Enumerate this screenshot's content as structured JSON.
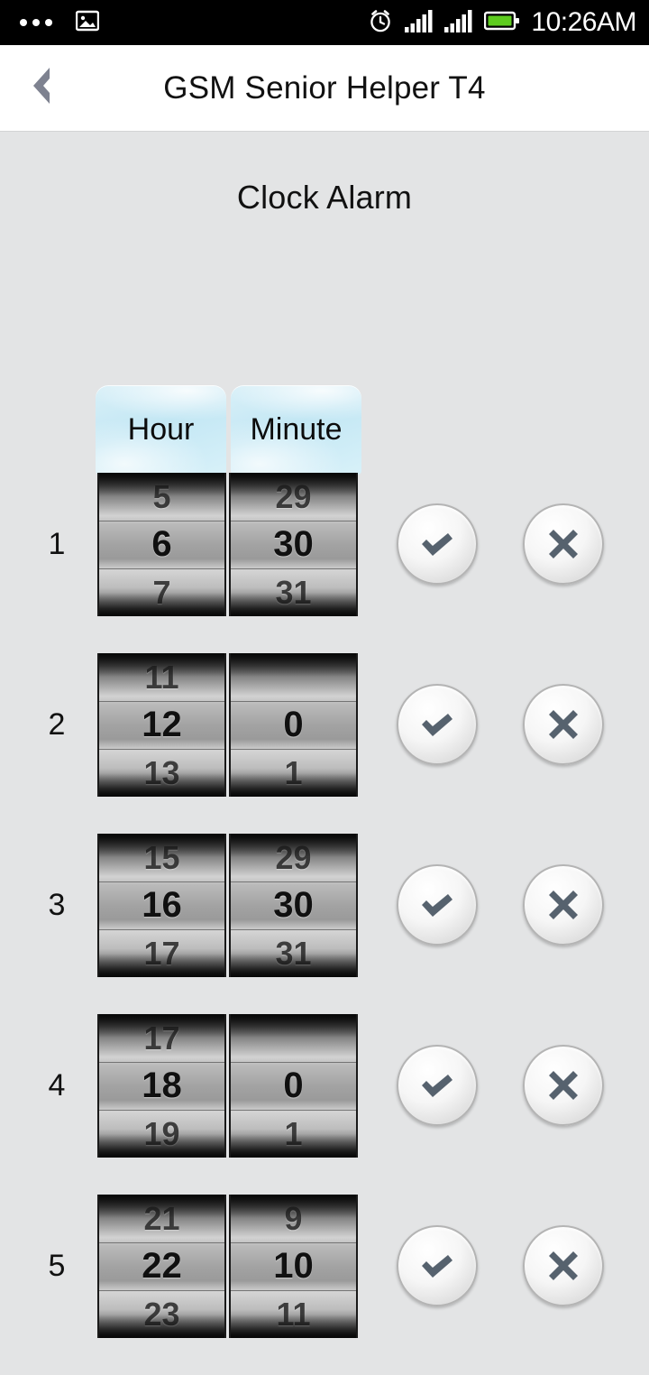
{
  "statusbar": {
    "time": "10:26AM",
    "icons": [
      "overflow-dots-icon",
      "image-icon",
      "alarm-clock-icon",
      "signal-bars-sim1-icon",
      "signal-bars-sim2-icon",
      "battery-icon"
    ],
    "battery_color": "#5ecc1f"
  },
  "titlebar": {
    "back_label": "back-chevron-icon",
    "title": "GSM Senior Helper T4"
  },
  "main": {
    "page_title": "Clock Alarm",
    "columns": [
      {
        "label": "Hour"
      },
      {
        "label": "Minute"
      }
    ],
    "accent_tab_color": "#c3e7f4",
    "icon_color": "#56626e",
    "confirm_label": "check-icon",
    "delete_label": "cross-icon",
    "alarms": [
      {
        "index": "1",
        "hour": {
          "prev": "5",
          "value": "6",
          "next": "7"
        },
        "minute": {
          "prev": "29",
          "value": "30",
          "next": "31"
        }
      },
      {
        "index": "2",
        "hour": {
          "prev": "11",
          "value": "12",
          "next": "13"
        },
        "minute": {
          "prev": "",
          "value": "0",
          "next": "1"
        }
      },
      {
        "index": "3",
        "hour": {
          "prev": "15",
          "value": "16",
          "next": "17"
        },
        "minute": {
          "prev": "29",
          "value": "30",
          "next": "31"
        }
      },
      {
        "index": "4",
        "hour": {
          "prev": "17",
          "value": "18",
          "next": "19"
        },
        "minute": {
          "prev": "",
          "value": "0",
          "next": "1"
        }
      },
      {
        "index": "5",
        "hour": {
          "prev": "21",
          "value": "22",
          "next": "23"
        },
        "minute": {
          "prev": "9",
          "value": "10",
          "next": "11"
        }
      }
    ]
  }
}
